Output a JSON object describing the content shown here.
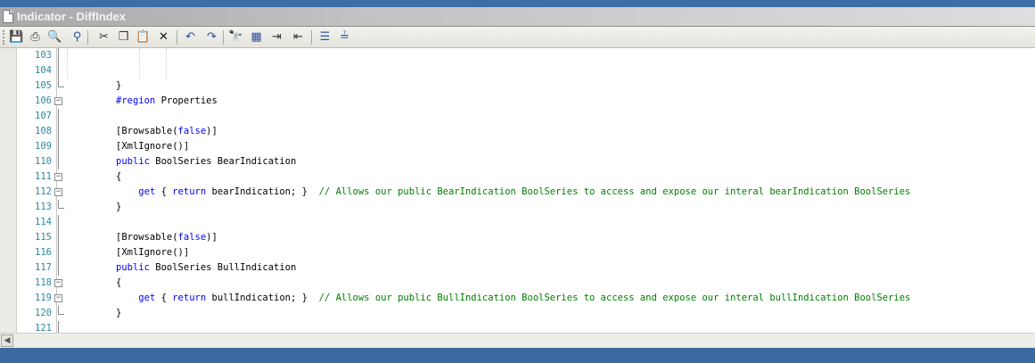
{
  "window": {
    "title": "Indicator - DiffIndex"
  },
  "toolbar": [
    {
      "name": "save-icon",
      "glyph": "💾",
      "color": "#2a52a8"
    },
    {
      "name": "print-icon",
      "glyph": "⎙",
      "color": "#333333"
    },
    {
      "name": "print-preview-icon",
      "glyph": "🔍",
      "color": "#333333"
    },
    {
      "name": "page-setup-icon",
      "glyph": "⚲",
      "color": "#2a52a8"
    },
    {
      "name": "cut-icon",
      "glyph": "✂",
      "color": "#333333"
    },
    {
      "name": "copy-icon",
      "glyph": "❐",
      "color": "#333333"
    },
    {
      "name": "paste-icon",
      "glyph": "📋",
      "color": "#a67c2a"
    },
    {
      "name": "delete-icon",
      "glyph": "✕",
      "color": "#111111"
    },
    {
      "name": "undo-icon",
      "glyph": "↶",
      "color": "#2a52a8"
    },
    {
      "name": "redo-icon",
      "glyph": "↷",
      "color": "#2a52a8"
    },
    {
      "name": "find-icon",
      "glyph": "🔭",
      "color": "#333333"
    },
    {
      "name": "replace-icon",
      "glyph": "▦",
      "color": "#2a52a8"
    },
    {
      "name": "indent-icon",
      "glyph": "⇥",
      "color": "#333333"
    },
    {
      "name": "outdent-icon",
      "glyph": "⇤",
      "color": "#333333"
    },
    {
      "name": "comment-icon",
      "glyph": "☰",
      "color": "#2a52a8"
    },
    {
      "name": "uncomment-icon",
      "glyph": "≟",
      "color": "#2a52a8"
    }
  ],
  "lines": [
    {
      "num": "103",
      "fold": "line",
      "tokens": []
    },
    {
      "num": "104",
      "fold": "line",
      "tokens": []
    },
    {
      "num": "105",
      "fold": "end",
      "tokens": [
        {
          "t": "}"
        }
      ]
    },
    {
      "num": "106",
      "fold": "box",
      "tokens": [
        {
          "t": "#region",
          "k": "kw"
        },
        {
          "t": " Properties"
        }
      ]
    },
    {
      "num": "107",
      "fold": "line",
      "tokens": []
    },
    {
      "num": "108",
      "fold": "line",
      "tokens": [
        {
          "t": "[Browsable("
        },
        {
          "t": "false",
          "k": "kw"
        },
        {
          "t": ")]"
        }
      ]
    },
    {
      "num": "109",
      "fold": "line",
      "tokens": [
        {
          "t": "[XmlIgnore()]"
        }
      ]
    },
    {
      "num": "110",
      "fold": "line",
      "tokens": [
        {
          "t": "public",
          "k": "kw"
        },
        {
          "t": " BoolSeries BearIndication"
        }
      ]
    },
    {
      "num": "111",
      "fold": "box",
      "tokens": [
        {
          "t": "{"
        }
      ]
    },
    {
      "num": "112",
      "fold": "box",
      "tokens": [
        {
          "t": "    "
        },
        {
          "t": "get",
          "k": "kw"
        },
        {
          "t": " { "
        },
        {
          "t": "return",
          "k": "kw"
        },
        {
          "t": " bearIndication; }  "
        },
        {
          "t": "// Allows our public BearIndication BoolSeries to access and expose our interal bearIndication BoolSeries",
          "k": "cm"
        }
      ]
    },
    {
      "num": "113",
      "fold": "end",
      "tokens": [
        {
          "t": "}"
        }
      ]
    },
    {
      "num": "114",
      "fold": "line",
      "tokens": []
    },
    {
      "num": "115",
      "fold": "line",
      "tokens": [
        {
          "t": "[Browsable("
        },
        {
          "t": "false",
          "k": "kw"
        },
        {
          "t": ")]"
        }
      ]
    },
    {
      "num": "116",
      "fold": "line",
      "tokens": [
        {
          "t": "[XmlIgnore()]"
        }
      ]
    },
    {
      "num": "117",
      "fold": "line",
      "tokens": [
        {
          "t": "public",
          "k": "kw"
        },
        {
          "t": " BoolSeries BullIndication"
        }
      ]
    },
    {
      "num": "118",
      "fold": "box",
      "tokens": [
        {
          "t": "{"
        }
      ]
    },
    {
      "num": "119",
      "fold": "box",
      "tokens": [
        {
          "t": "    "
        },
        {
          "t": "get",
          "k": "kw"
        },
        {
          "t": " { "
        },
        {
          "t": "return",
          "k": "kw"
        },
        {
          "t": " bullIndication; }  "
        },
        {
          "t": "// Allows our public BullIndication BoolSeries to access and expose our interal bullIndication BoolSeries",
          "k": "cm"
        }
      ]
    },
    {
      "num": "120",
      "fold": "end",
      "tokens": [
        {
          "t": "}"
        }
      ]
    },
    {
      "num": "121",
      "fold": "line",
      "tokens": []
    }
  ],
  "scrollbar": {
    "left_arrow": "◀"
  }
}
